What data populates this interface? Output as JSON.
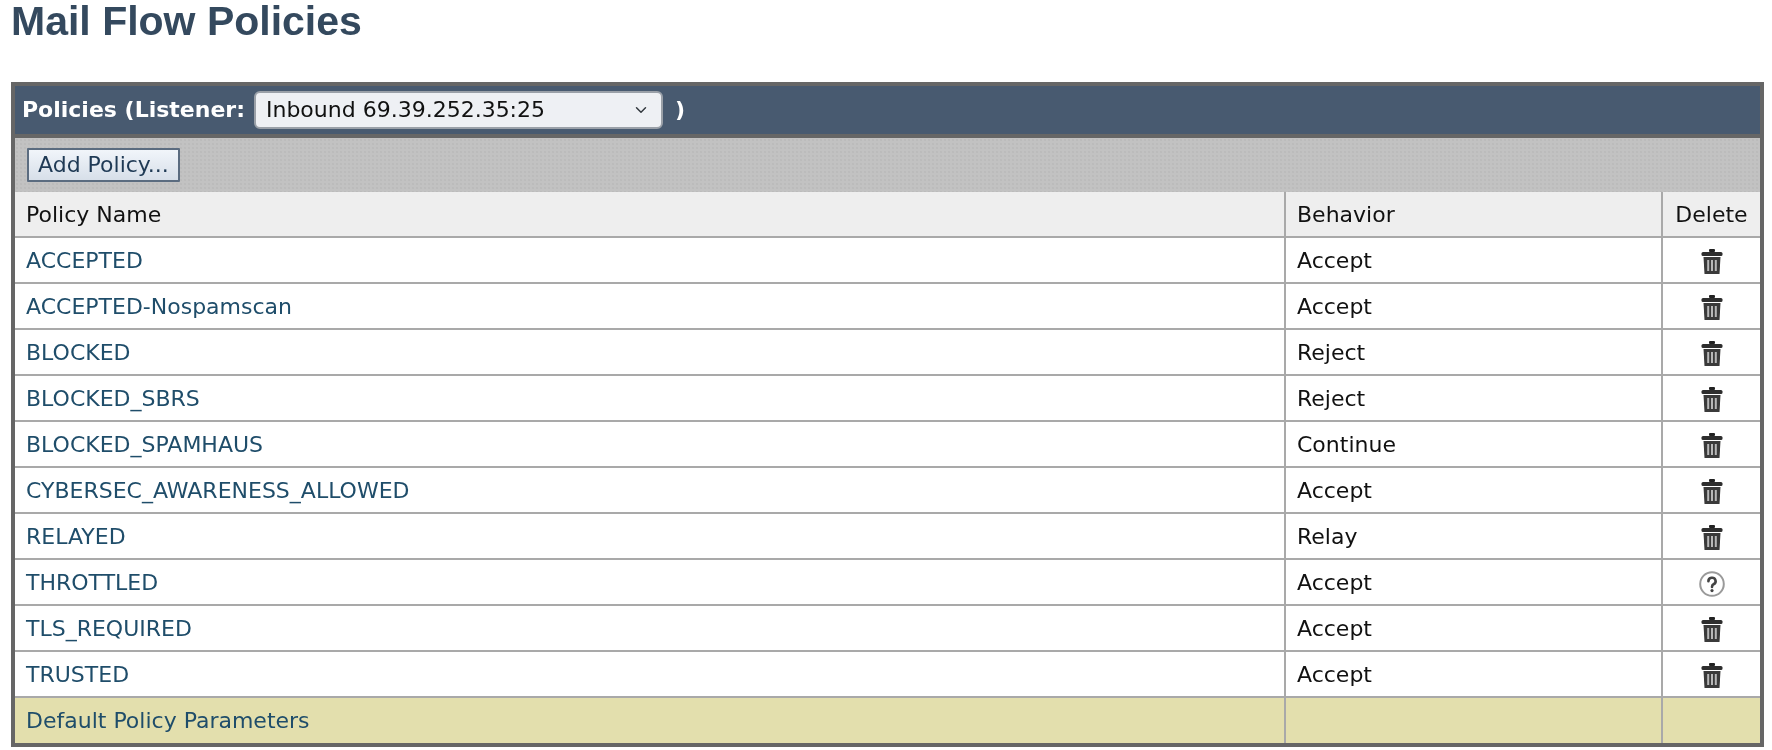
{
  "page": {
    "title": "Mail Flow Policies"
  },
  "panel": {
    "title": "Policies (Listener:",
    "listener": {
      "value": "Inbound 69.39.252.35:25"
    },
    "title_end": ")",
    "add_button": "Add Policy..."
  },
  "table": {
    "columns": [
      "Policy Name",
      "Behavior",
      "Delete"
    ],
    "rows": [
      {
        "name": "ACCEPTED",
        "behavior": "Accept",
        "kind": "trash"
      },
      {
        "name": "ACCEPTED-Nospamscan",
        "behavior": "Accept",
        "kind": "trash"
      },
      {
        "name": "BLOCKED",
        "behavior": "Reject",
        "kind": "trash"
      },
      {
        "name": "BLOCKED_SBRS",
        "behavior": "Reject",
        "kind": "trash"
      },
      {
        "name": "BLOCKED_SPAMHAUS",
        "behavior": "Continue",
        "kind": "trash"
      },
      {
        "name": "CYBERSEC_AWARENESS_ALLOWED",
        "behavior": "Accept",
        "kind": "trash"
      },
      {
        "name": "RELAYED",
        "behavior": "Relay",
        "kind": "trash"
      },
      {
        "name": "THROTTLED",
        "behavior": "Accept",
        "kind": "help"
      },
      {
        "name": "TLS_REQUIRED",
        "behavior": "Accept",
        "kind": "trash"
      },
      {
        "name": "TRUSTED",
        "behavior": "Accept",
        "kind": "trash"
      }
    ],
    "default_row": {
      "name": "Default Policy Parameters"
    }
  }
}
